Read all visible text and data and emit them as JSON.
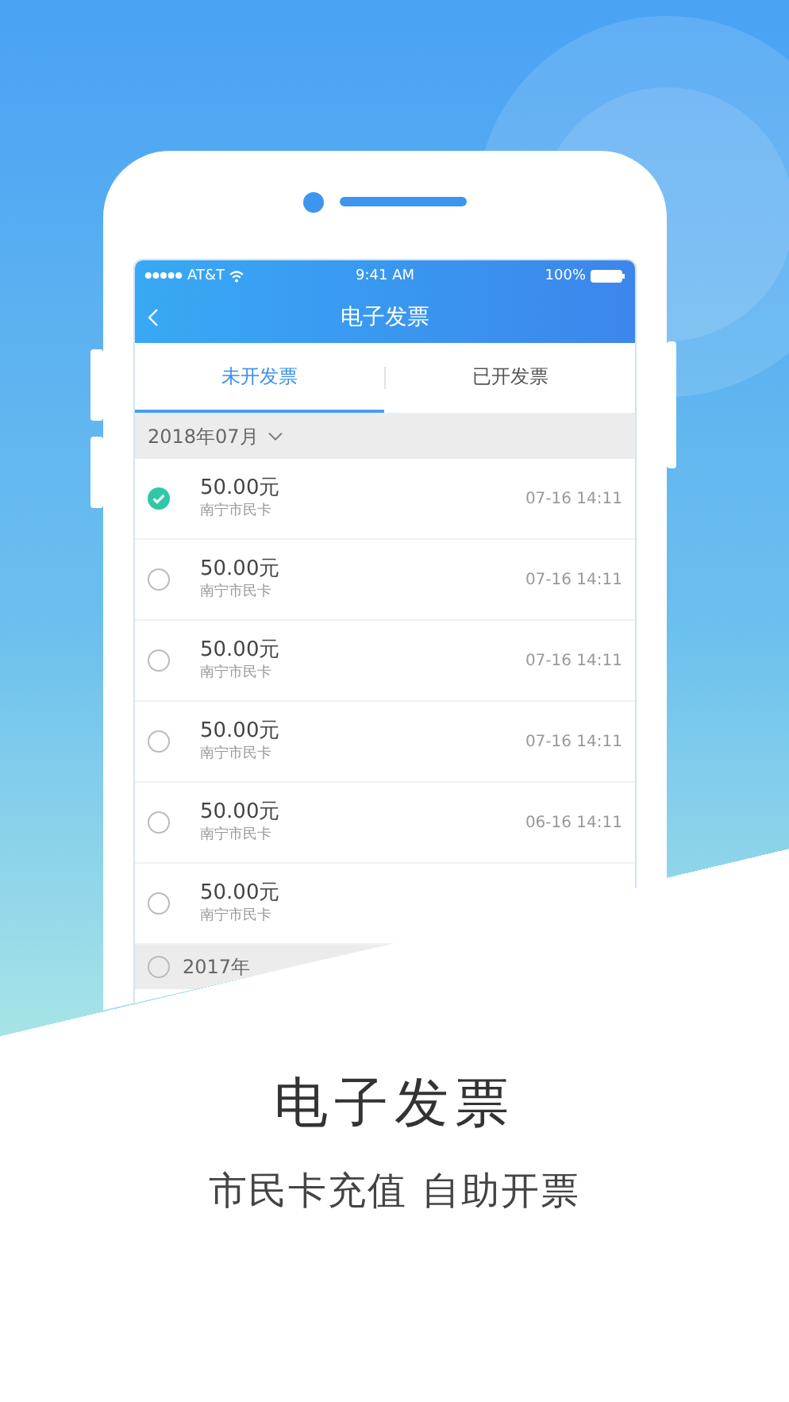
{
  "status_bar": {
    "carrier": "AT&T",
    "time": "9:41 AM",
    "battery": "100%"
  },
  "nav": {
    "title": "电子发票"
  },
  "tabs": [
    {
      "label": "未开发票",
      "selected": true
    },
    {
      "label": "已开发票",
      "selected": false
    }
  ],
  "groups": [
    {
      "kind": "month",
      "label": "2018年07月",
      "rows": [
        {
          "amount": "50.00元",
          "card": "南宁市民卡",
          "time": "07-16 14:11",
          "selected": true
        },
        {
          "amount": "50.00元",
          "card": "南宁市民卡",
          "time": "07-16 14:11",
          "selected": false
        },
        {
          "amount": "50.00元",
          "card": "南宁市民卡",
          "time": "07-16 14:11",
          "selected": false
        },
        {
          "amount": "50.00元",
          "card": "南宁市民卡",
          "time": "07-16 14:11",
          "selected": false
        },
        {
          "amount": "50.00元",
          "card": "南宁市民卡",
          "time": "06-16 14:11",
          "selected": false
        },
        {
          "amount": "50.00元",
          "card": "南宁市民卡",
          "selected": false
        }
      ]
    },
    {
      "kind": "year",
      "label": "2017年",
      "selected": false
    }
  ],
  "promo": {
    "headline": "电子发票",
    "subtitle": "市民卡充值 自助开票"
  }
}
